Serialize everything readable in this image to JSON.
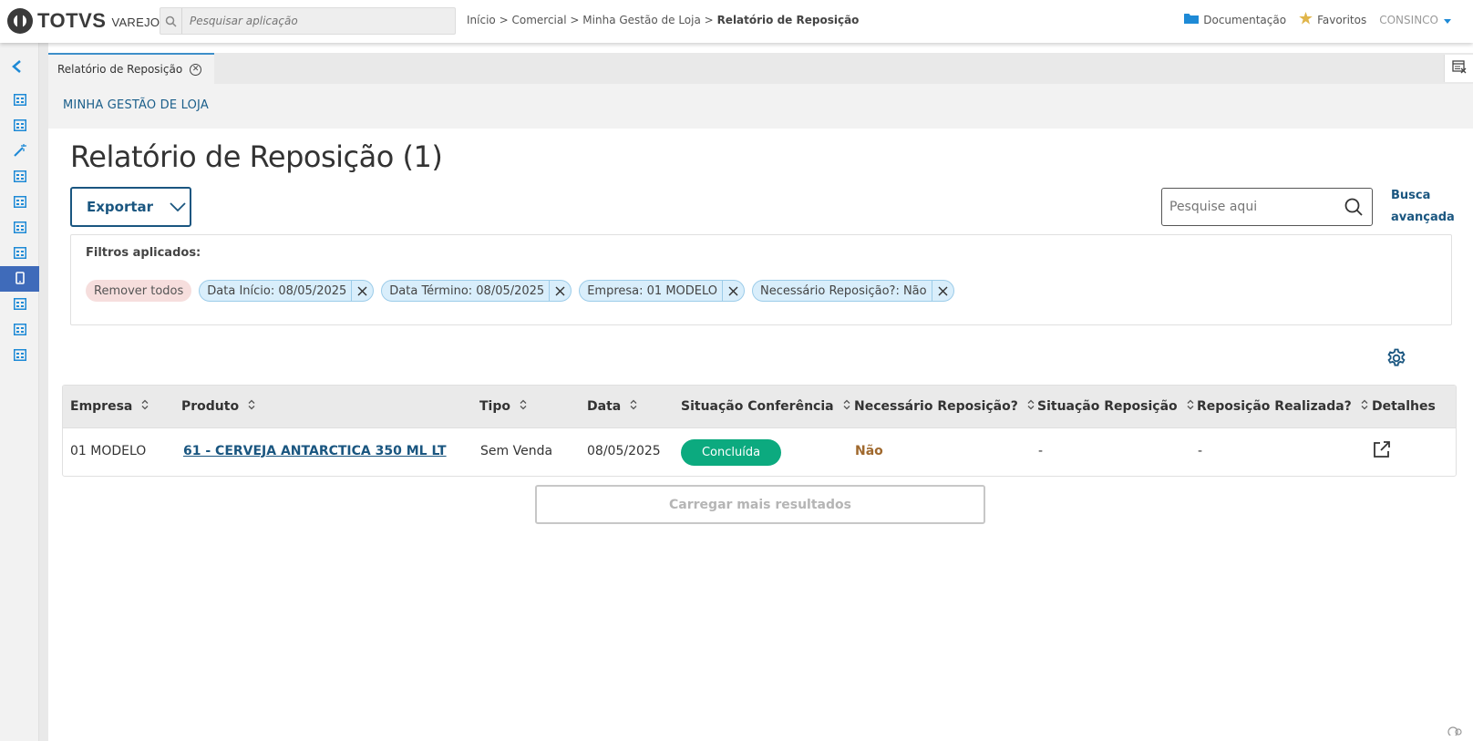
{
  "header": {
    "logo_text": "TOTVS",
    "logo_sub": "VAREJO",
    "search_placeholder": "Pesquisar aplicação",
    "breadcrumb": {
      "items": [
        "Início",
        "Comercial",
        "Minha Gestão de Loja"
      ],
      "separator": ">",
      "current": "Relatório de Reposição"
    },
    "documentation": "Documentação",
    "favorites": "Favoritos",
    "user": "CONSINCO"
  },
  "sidebar": {
    "items": [
      "grid-icon",
      "grid-icon",
      "wand-icon",
      "grid-icon",
      "grid-icon",
      "grid-icon",
      "grid-icon",
      "mobile-icon",
      "grid-icon",
      "grid-icon",
      "grid-icon"
    ],
    "active_index": 7
  },
  "tabs": [
    {
      "label": "Relatório de Reposição"
    }
  ],
  "module_title": "MINHA GESTÃO DE LOJA",
  "page": {
    "title": "Relatório de Reposição (1)",
    "export_label": "Exportar",
    "search_placeholder": "Pesquise aqui",
    "advanced_search_line1": "Busca",
    "advanced_search_line2": "avançada"
  },
  "filters": {
    "title": "Filtros aplicados:",
    "remove_all": "Remover todos",
    "chips": [
      "Data Início: 08/05/2025",
      "Data Término: 08/05/2025",
      "Empresa: 01 MODELO",
      "Necessário Reposição?: Não"
    ]
  },
  "table": {
    "columns": [
      "Empresa",
      "Produto",
      "Tipo",
      "Data",
      "Situação Conferência",
      "Necessário Reposição?",
      "Situação Reposição",
      "Reposição Realizada?",
      "Detalhes"
    ],
    "rows": [
      {
        "empresa": "01 MODELO",
        "produto": "61 - CERVEJA ANTARCTICA 350 ML LT",
        "tipo": "Sem Venda",
        "data": "08/05/2025",
        "situacao_conferencia": "Concluída",
        "necessario_reposicao": "Não",
        "situacao_reposicao": "-",
        "reposicao_realizada": "-"
      }
    ]
  },
  "load_more": "Carregar mais resultados",
  "colors": {
    "primary": "#1a5680",
    "success_badge": "#0caa7f",
    "nao_text": "#a0692e",
    "chip_bg": "#d9eefb",
    "remove_chip_bg": "#f6dedd",
    "sidebar_active": "#3f6bba"
  }
}
